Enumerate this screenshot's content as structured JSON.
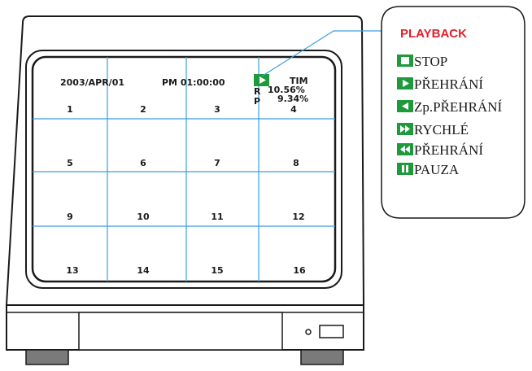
{
  "osd": {
    "date": "2003/APR/01",
    "time": "PM 01:00:00",
    "mode": "TIM",
    "r_label": "R",
    "r_value": "10.56%",
    "p_label": "P",
    "p_value": "9.34%"
  },
  "channels": [
    "1",
    "2",
    "3",
    "4",
    "5",
    "6",
    "7",
    "8",
    "9",
    "10",
    "11",
    "12",
    "13",
    "14",
    "15",
    "16"
  ],
  "legend": {
    "title": "PLAYBACK",
    "items": [
      {
        "icon": "stop-icon",
        "label": "STOP"
      },
      {
        "icon": "play-icon",
        "label": "PŘEHRÁNÍ"
      },
      {
        "icon": "reverse-play-icon",
        "label": "Zp.PŘEHRÁNÍ"
      },
      {
        "icon": "fast-forward-icon",
        "label": "RYCHLÉ"
      },
      {
        "icon": "rewind-icon",
        "label": "PŘEHRÁNÍ"
      },
      {
        "icon": "pause-icon",
        "label": "PAUZA"
      }
    ]
  },
  "colors": {
    "icon_green": "#1e9a3c",
    "title_red": "#e0202a",
    "grid_blue": "#3aa0e0",
    "outline": "#1a1a1a"
  }
}
